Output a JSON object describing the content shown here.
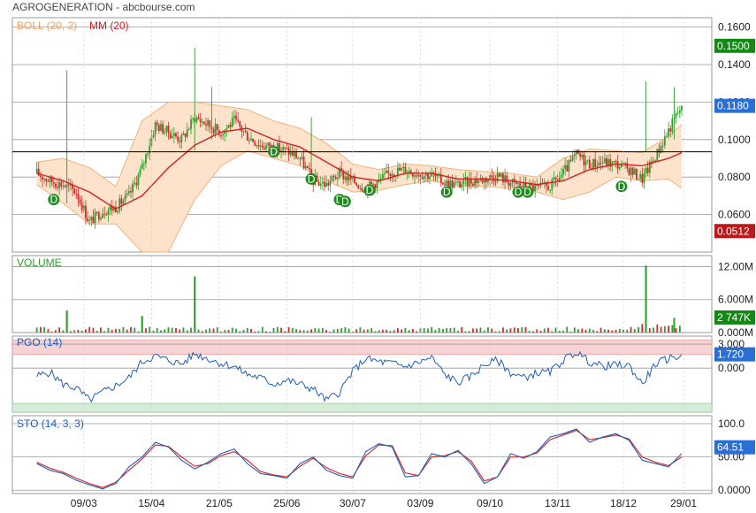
{
  "header": {
    "title": "AGROGENERATION - abcbourse.com"
  },
  "colors": {
    "grid": "#9a9a9a",
    "bollinger_fill": "#fde3cc",
    "bollinger_line": "#f2b27a",
    "mm_line": "#d62020",
    "up": "#2f9e2f",
    "down": "#d42a2a",
    "pgo_line": "#1f5fb5",
    "pgo_upper_band": "#f8d3d3",
    "pgo_lower_band": "#d6ecd6",
    "sto_k": "#1f5fb5",
    "sto_d": "#d62020",
    "dividend_marker": "#1f8a1f",
    "badge_green": "#138a13",
    "badge_blue": "#2a6fd6",
    "badge_red": "#c01818"
  },
  "chart_data": [
    {
      "name": "price",
      "type": "candlestick",
      "legend": [
        {
          "label": "BOLL (20, 2)",
          "color": "#f0a060"
        },
        {
          "label": "MM (20)",
          "color": "#d62020"
        }
      ],
      "ylim": [
        0.04,
        0.165
      ],
      "yticks": [
        "0.1600",
        "0.1400",
        "0.1200",
        "0.1000",
        "0.0800",
        "0.0600"
      ],
      "ytick_values": [
        0.16,
        0.14,
        0.12,
        0.1,
        0.08,
        0.06
      ],
      "hline": 0.0935,
      "badges": [
        {
          "text": "0.1500",
          "value": 0.15,
          "color": "#138a13"
        },
        {
          "text": "0.1180",
          "value": 0.118,
          "color": "#2a6fd6"
        },
        {
          "text": "0.0512",
          "value": 0.0512,
          "color": "#c01818"
        }
      ],
      "series": [
        {
          "name": "close",
          "x": [
            0,
            7,
            14,
            21,
            28,
            35,
            42,
            49,
            56,
            63,
            70,
            77,
            84,
            91,
            98,
            105,
            112,
            119,
            126,
            133,
            140,
            147,
            154,
            161,
            168,
            175,
            182,
            189,
            196,
            203,
            210,
            217,
            224,
            231,
            238,
            245,
            252,
            259,
            266,
            273,
            280,
            287,
            294,
            301,
            308,
            315,
            322,
            329,
            336,
            343
          ],
          "values": [
            0.082,
            0.078,
            0.076,
            0.072,
            0.056,
            0.062,
            0.064,
            0.07,
            0.085,
            0.108,
            0.104,
            0.1,
            0.112,
            0.108,
            0.104,
            0.11,
            0.102,
            0.097,
            0.096,
            0.094,
            0.09,
            0.078,
            0.076,
            0.082,
            0.078,
            0.074,
            0.078,
            0.083,
            0.084,
            0.082,
            0.081,
            0.077,
            0.076,
            0.078,
            0.079,
            0.081,
            0.077,
            0.075,
            0.074,
            0.075,
            0.082,
            0.092,
            0.087,
            0.088,
            0.087,
            0.084,
            0.079,
            0.091,
            0.105,
            0.118
          ]
        },
        {
          "name": "mm20",
          "x": [
            0,
            14,
            28,
            42,
            56,
            70,
            84,
            98,
            112,
            126,
            140,
            154,
            168,
            182,
            196,
            210,
            224,
            238,
            252,
            266,
            280,
            294,
            308,
            322,
            336,
            343
          ],
          "values": [
            0.082,
            0.078,
            0.072,
            0.063,
            0.07,
            0.085,
            0.097,
            0.104,
            0.106,
            0.1,
            0.096,
            0.088,
            0.08,
            0.078,
            0.082,
            0.082,
            0.079,
            0.079,
            0.078,
            0.076,
            0.078,
            0.084,
            0.087,
            0.086,
            0.09,
            0.093
          ]
        },
        {
          "name": "boll_upper",
          "x": [
            0,
            14,
            28,
            42,
            56,
            70,
            84,
            98,
            112,
            126,
            140,
            154,
            168,
            182,
            196,
            210,
            224,
            238,
            252,
            266,
            280,
            294,
            308,
            322,
            336,
            343
          ],
          "values": [
            0.088,
            0.09,
            0.085,
            0.075,
            0.11,
            0.12,
            0.12,
            0.118,
            0.116,
            0.11,
            0.106,
            0.098,
            0.087,
            0.084,
            0.087,
            0.086,
            0.084,
            0.083,
            0.082,
            0.08,
            0.09,
            0.095,
            0.094,
            0.093,
            0.102,
            0.108
          ]
        },
        {
          "name": "boll_lower",
          "x": [
            0,
            14,
            28,
            42,
            56,
            70,
            84,
            98,
            112,
            126,
            140,
            154,
            168,
            182,
            196,
            210,
            224,
            238,
            252,
            266,
            280,
            294,
            308,
            322,
            336,
            343
          ],
          "values": [
            0.076,
            0.066,
            0.055,
            0.055,
            0.04,
            0.04,
            0.068,
            0.086,
            0.094,
            0.09,
            0.086,
            0.078,
            0.072,
            0.073,
            0.076,
            0.078,
            0.075,
            0.075,
            0.074,
            0.072,
            0.068,
            0.072,
            0.08,
            0.078,
            0.079,
            0.074
          ]
        }
      ],
      "dividend_markers": [
        {
          "x": 9,
          "value": 0.068,
          "label": "D"
        },
        {
          "x": 126,
          "value": 0.0935,
          "label": "D"
        },
        {
          "x": 146,
          "value": 0.079,
          "label": "D"
        },
        {
          "x": 161,
          "value": 0.068,
          "label": "D"
        },
        {
          "x": 164,
          "value": 0.067,
          "label": "D"
        },
        {
          "x": 177,
          "value": 0.073,
          "label": "D"
        },
        {
          "x": 218,
          "value": 0.072,
          "label": "D"
        },
        {
          "x": 256,
          "value": 0.072,
          "label": "D"
        },
        {
          "x": 261,
          "value": 0.072,
          "label": "D"
        },
        {
          "x": 311,
          "value": 0.075,
          "label": "D"
        }
      ]
    },
    {
      "name": "volume",
      "type": "bar",
      "title": "VOLUME",
      "ylim": [
        0,
        14
      ],
      "yticks": [
        "12.00M",
        "6.000M",
        "0.000M"
      ],
      "ytick_values": [
        12,
        6,
        0
      ],
      "badge": {
        "text": "2 747K",
        "value": 2.747,
        "color": "#138a13"
      },
      "spikes": [
        {
          "x": 16,
          "value": 4.0
        },
        {
          "x": 84,
          "value": 10.2
        },
        {
          "x": 56,
          "value": 3.0
        },
        {
          "x": 324,
          "value": 12.2
        },
        {
          "x": 339,
          "value": 2.7
        }
      ]
    },
    {
      "name": "pgo",
      "type": "line",
      "title": "PGO (14)",
      "ylim": [
        -5.5,
        4
      ],
      "yticks": [
        "3.000",
        "0.000"
      ],
      "ytick_values": [
        3,
        0
      ],
      "upper_band": [
        1.7,
        3.5
      ],
      "lower_band": [
        -5.5,
        -4.4
      ],
      "badge": {
        "text": "1.720",
        "value": 1.72,
        "color": "#2a6fd6"
      },
      "values": [
        -1.0,
        -0.5,
        -2.0,
        -2.5,
        -4.0,
        -3.0,
        -2.2,
        -1.2,
        0.8,
        1.5,
        1.0,
        0.5,
        1.8,
        1.2,
        0.6,
        0.2,
        -0.8,
        -1.2,
        -2.0,
        -1.5,
        -2.0,
        -2.6,
        -4.0,
        -3.0,
        -0.4,
        1.2,
        0.8,
        0.6,
        0.2,
        0.7,
        1.3,
        -0.8,
        -1.8,
        -1.0,
        0.4,
        1.0,
        -0.6,
        -1.2,
        -0.6,
        -0.5,
        1.0,
        2.0,
        0.8,
        0.2,
        0.4,
        0.3,
        -2.0,
        0.5,
        1.2,
        1.6
      ]
    },
    {
      "name": "sto",
      "type": "line",
      "title": "STO (14, 3, 3)",
      "ylim": [
        -5,
        112
      ],
      "yticks": [
        "100.0",
        "50.00",
        "0.0000"
      ],
      "ytick_values": [
        100,
        50,
        0
      ],
      "badge": {
        "text": "64.51",
        "value": 64.51,
        "color": "#2a6fd6"
      },
      "series": [
        {
          "name": "%K",
          "values": [
            40,
            30,
            25,
            15,
            8,
            2,
            10,
            35,
            50,
            72,
            65,
            45,
            32,
            42,
            55,
            62,
            40,
            25,
            22,
            18,
            40,
            50,
            30,
            22,
            18,
            58,
            70,
            65,
            20,
            22,
            55,
            50,
            60,
            40,
            10,
            20,
            55,
            48,
            58,
            80,
            85,
            92,
            72,
            80,
            85,
            75,
            45,
            40,
            35,
            55
          ]
        },
        {
          "name": "%D",
          "values": [
            42,
            33,
            27,
            18,
            10,
            4,
            12,
            30,
            47,
            68,
            66,
            50,
            36,
            40,
            52,
            58,
            45,
            28,
            23,
            20,
            36,
            48,
            34,
            25,
            20,
            52,
            68,
            67,
            26,
            22,
            50,
            52,
            58,
            44,
            14,
            20,
            50,
            50,
            56,
            76,
            83,
            90,
            76,
            79,
            83,
            77,
            50,
            42,
            37,
            50
          ]
        }
      ]
    }
  ],
  "x_axis": {
    "labels": [
      "09/03",
      "15/04",
      "21/05",
      "25/06",
      "30/07",
      "03/09",
      "09/10",
      "13/11",
      "18/12",
      "29/01"
    ],
    "label_x": [
      25,
      61,
      97,
      133,
      168,
      204,
      241,
      277,
      312,
      344
    ],
    "range": [
      -13,
      359
    ]
  }
}
